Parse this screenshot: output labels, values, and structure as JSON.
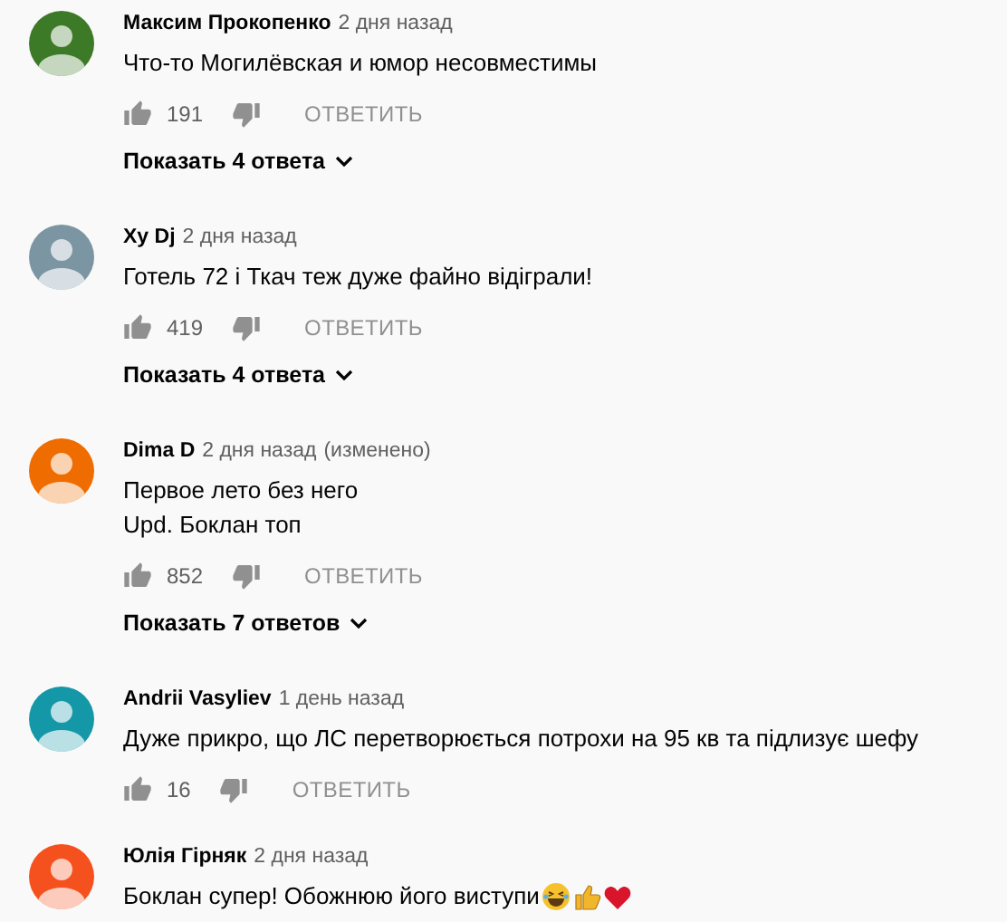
{
  "comments": [
    {
      "author": "Максим Прокопенко",
      "time": "2 дня назад",
      "color": "#3d7a27",
      "lines": [
        "Что-то Могилёвская и юмор несовместимы"
      ],
      "likes": "191",
      "reply": "ОТВЕТИТЬ",
      "replies": "Показать 4 ответа"
    },
    {
      "author": "Xy Dj",
      "time": "2 дня назад",
      "color": "#7b95a3",
      "lines": [
        "Готель 72 і Ткач теж дуже файно відіграли!"
      ],
      "likes": "419",
      "reply": "ОТВЕТИТЬ",
      "replies": "Показать 4 ответа"
    },
    {
      "author": "Dima D",
      "time": "2 дня назад",
      "edited": "(изменено)",
      "color": "#ef6c00",
      "lines": [
        "Первое лето без него",
        "Upd. Боклан топ"
      ],
      "likes": "852",
      "reply": "ОТВЕТИТЬ",
      "replies": "Показать 7 ответов"
    },
    {
      "author": "Andrii Vasyliev",
      "time": "1 день назад",
      "color": "#1497a7",
      "lines": [
        "Дуже прикро, що ЛС перетворюється потрохи на 95 кв та підлизує шефу"
      ],
      "likes": "16",
      "reply": "ОТВЕТИТЬ"
    },
    {
      "author": "Юлія Гірняк",
      "time": "2 дня назад",
      "color": "#f4511e",
      "lines": [
        "Боклан супер! Обожнюю його виступи"
      ],
      "emoji": [
        {
          "kind": "laugh"
        },
        {
          "kind": "thumbs-up"
        },
        {
          "kind": "heart"
        }
      ]
    }
  ]
}
